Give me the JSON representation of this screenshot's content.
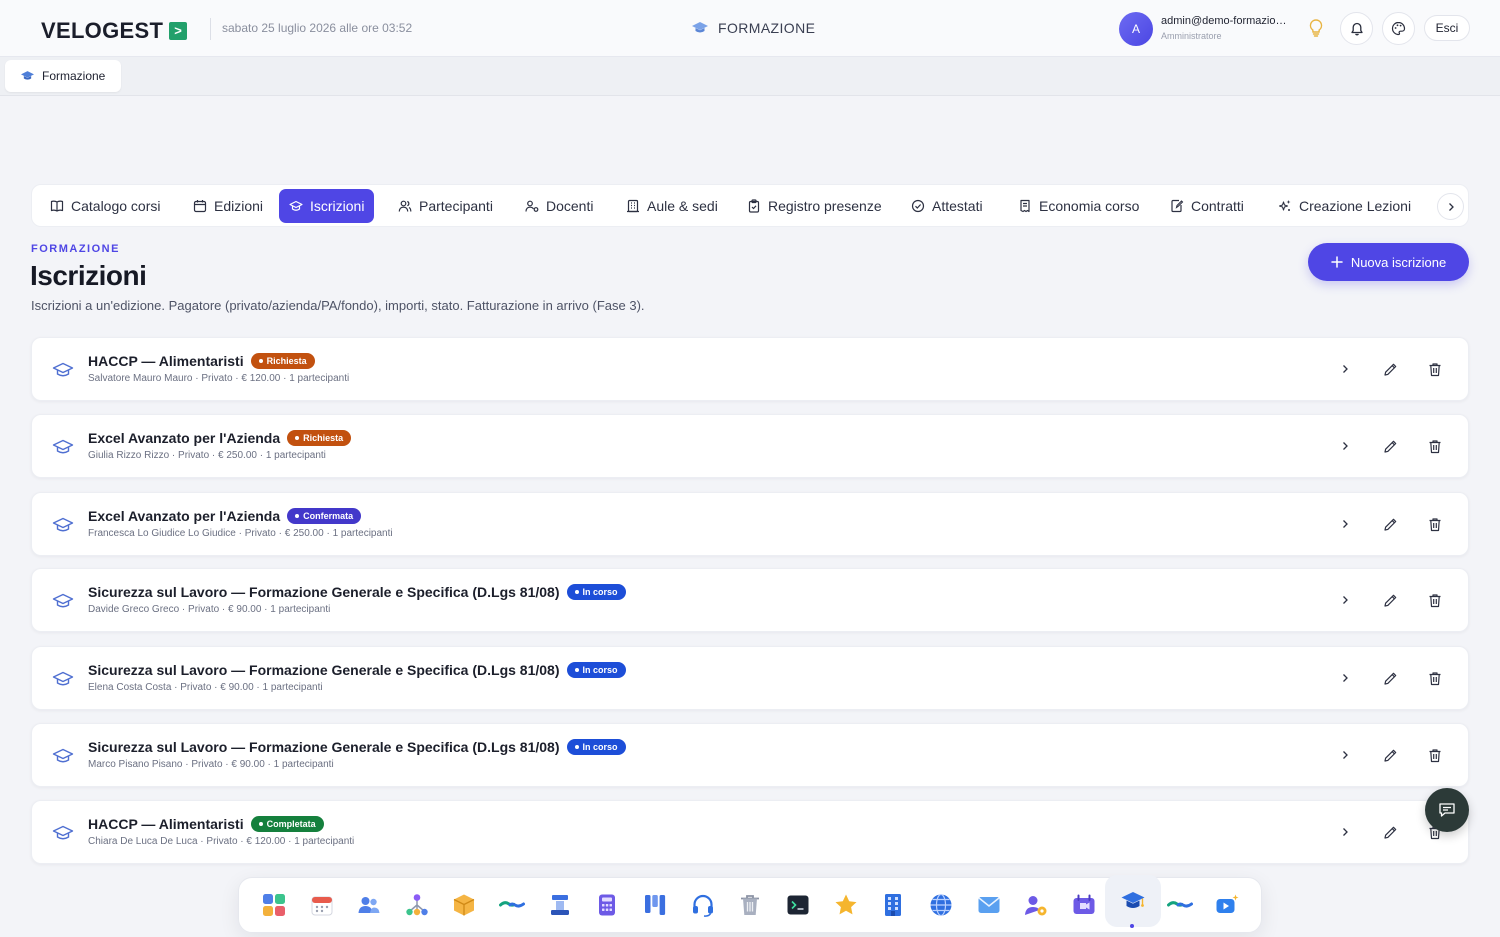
{
  "header": {
    "brand": "VELOGEST",
    "brand_mark": ">",
    "datetime": "sabato 25 luglio 2026 alle ore 03:52",
    "section": "FORMAZIONE",
    "user_initial": "A",
    "user_name": "admin@demo-formazio…",
    "user_role": "Amministratore",
    "logout_label": "Esci"
  },
  "window_tab": {
    "label": "Formazione"
  },
  "nav": {
    "tabs": [
      {
        "label": "Catalogo corsi",
        "icon": "book-icon"
      },
      {
        "label": "Edizioni",
        "icon": "calendar-icon"
      },
      {
        "label": "Iscrizioni",
        "icon": "graduation-cap-icon",
        "active": true
      },
      {
        "label": "Partecipanti",
        "icon": "users-icon"
      },
      {
        "label": "Docenti",
        "icon": "teacher-icon"
      },
      {
        "label": "Aule & sedi",
        "icon": "building-icon"
      },
      {
        "label": "Registro presenze",
        "icon": "clipboard-icon"
      },
      {
        "label": "Attestati",
        "icon": "check-circle-icon"
      },
      {
        "label": "Economia corso",
        "icon": "receipt-icon"
      },
      {
        "label": "Contratti",
        "icon": "document-edit-icon"
      },
      {
        "label": "Creazione Lezioni",
        "icon": "sparkles-icon"
      }
    ]
  },
  "page": {
    "eyebrow": "FORMAZIONE",
    "title": "Iscrizioni",
    "subtitle": "Iscrizioni a un'edizione. Pagatore (privato/azienda/PA/fondo), importi, stato. Fatturazione in arrivo (Fase 3).",
    "new_button": "Nuova iscrizione"
  },
  "status_colors": {
    "Richiesta": "#c2510f",
    "Confermata": "#4338ca",
    "In corso": "#1d4ed8",
    "Completata": "#15803d"
  },
  "enrollments": [
    {
      "course": "HACCP — Alimentaristi",
      "status": "Richiesta",
      "meta": "Salvatore Mauro Mauro · Privato · € 120.00 · 1 partecipanti"
    },
    {
      "course": "Excel Avanzato per l'Azienda",
      "status": "Richiesta",
      "meta": "Giulia Rizzo Rizzo · Privato · € 250.00 · 1 partecipanti"
    },
    {
      "course": "Excel Avanzato per l'Azienda",
      "status": "Confermata",
      "meta": "Francesca Lo Giudice Lo Giudice · Privato · € 250.00 · 1 partecipanti"
    },
    {
      "course": "Sicurezza sul Lavoro — Formazione Generale e Specifica (D.Lgs 81/08)",
      "status": "In corso",
      "meta": "Davide Greco Greco · Privato · € 90.00 · 1 partecipanti"
    },
    {
      "course": "Sicurezza sul Lavoro — Formazione Generale e Specifica (D.Lgs 81/08)",
      "status": "In corso",
      "meta": "Elena Costa Costa · Privato · € 90.00 · 1 partecipanti"
    },
    {
      "course": "Sicurezza sul Lavoro — Formazione Generale e Specifica (D.Lgs 81/08)",
      "status": "In corso",
      "meta": "Marco Pisano Pisano · Privato · € 90.00 · 1 partecipanti"
    },
    {
      "course": "HACCP — Alimentaristi",
      "status": "Completata",
      "meta": "Chiara De Luca De Luca · Privato · € 120.00 · 1 partecipanti"
    }
  ],
  "dock": {
    "apps": [
      "apps-grid-icon",
      "calendar-icon",
      "contacts-icon",
      "org-chart-icon",
      "package-icon",
      "handshake-icon",
      "cashier-icon",
      "calculator-icon",
      "kanban-icon",
      "headset-icon",
      "trash-icon",
      "terminal-icon",
      "star-icon",
      "office-building-icon",
      "globe-icon",
      "mail-icon",
      "user-settings-icon",
      "video-calendar-icon",
      "graduation-cap-icon",
      "handshake-alt-icon",
      "video-ai-icon"
    ],
    "active_index": 18
  }
}
